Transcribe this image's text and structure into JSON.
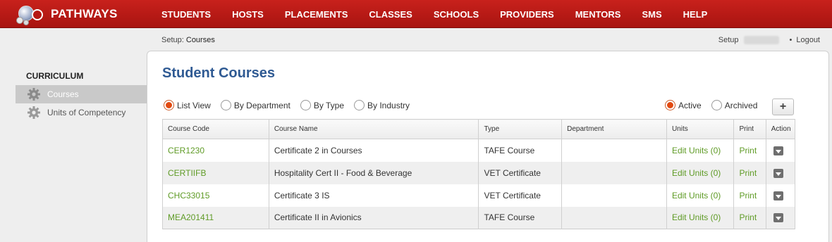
{
  "app": {
    "name": "PATHWAYS"
  },
  "nav": [
    "STUDENTS",
    "HOSTS",
    "PLACEMENTS",
    "CLASSES",
    "SCHOOLS",
    "PROVIDERS",
    "MENTORS",
    "SMS",
    "HELP"
  ],
  "breadcrumb": {
    "prefix": "Setup:",
    "current": "Courses"
  },
  "usernav": {
    "setup": "Setup",
    "logout": "Logout"
  },
  "sidebar": {
    "heading": "CURRICULUM",
    "items": [
      {
        "label": "Courses",
        "icon": "gear-icon",
        "active": true
      },
      {
        "label": "Units of Competency",
        "icon": "gear-icon",
        "active": false
      }
    ]
  },
  "page": {
    "title": "Student Courses"
  },
  "view_filters": [
    {
      "label": "List View",
      "selected": true
    },
    {
      "label": "By Department",
      "selected": false
    },
    {
      "label": "By Type",
      "selected": false
    },
    {
      "label": "By Industry",
      "selected": false
    }
  ],
  "status_filters": [
    {
      "label": "Active",
      "selected": true
    },
    {
      "label": "Archived",
      "selected": false
    }
  ],
  "add_button": {
    "label": "+"
  },
  "table": {
    "headers": [
      "Course Code",
      "Course Name",
      "Type",
      "Department",
      "Units",
      "Print",
      "Action"
    ],
    "rows": [
      {
        "code": "CER1230",
        "name": "Certificate 2 in Courses",
        "type": "TAFE Course",
        "department": "",
        "units": "Edit Units (0)",
        "print": "Print"
      },
      {
        "code": "CERTIIFB",
        "name": "Hospitality Cert II - Food & Beverage",
        "type": "VET Certificate",
        "department": "",
        "units": "Edit Units (0)",
        "print": "Print"
      },
      {
        "code": "CHC33015",
        "name": "Certificate 3 IS",
        "type": "VET Certificate",
        "department": "",
        "units": "Edit Units (0)",
        "print": "Print"
      },
      {
        "code": "MEA201411",
        "name": "Certificate II in Avionics",
        "type": "TAFE Course",
        "department": "",
        "units": "Edit Units (0)",
        "print": "Print"
      }
    ]
  },
  "colors": {
    "nav_red": "#b51612",
    "title_blue": "#2f5a93",
    "link_green": "#5f9b26",
    "radio_orange": "#e2490f"
  }
}
